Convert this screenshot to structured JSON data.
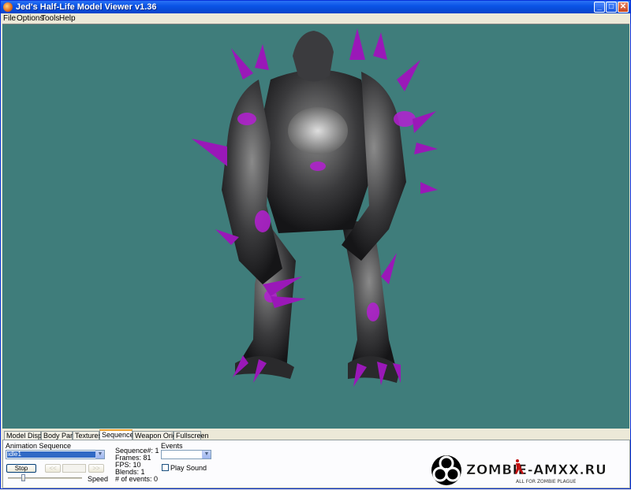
{
  "window": {
    "title": "Jed's Half-Life Model Viewer v1.36"
  },
  "titlebar_buttons": {
    "minimize": "_",
    "maximize": "□",
    "close": "✕"
  },
  "menu": [
    "File",
    "Options",
    "Tools",
    "Help"
  ],
  "tabs": [
    "Model Display",
    "Body Parts",
    "Textures",
    "Sequences",
    "Weapon Origin",
    "Fullscreen"
  ],
  "active_tab": "Sequences",
  "sequences": {
    "animation_label": "Animation Sequence",
    "animation_value": "idle1",
    "stop_label": "Stop",
    "prev_label": "<<",
    "next_label": ">>",
    "speed_label": "Speed",
    "info": {
      "sequence": "Sequence#: 1",
      "frames": "Frames: 81",
      "fps": "FPS: 10",
      "blends": "Blends: 1",
      "events_count": "# of events: 0"
    },
    "events_label": "Events",
    "play_sound_label": "Play Sound",
    "speed_slider_fraction": 0.2
  },
  "logo": {
    "text": "ZOMBIE-AMXX.RU",
    "tagline": "ALL FOR ZOMBIE PLAGUE"
  },
  "colors": {
    "viewport_bg": "#3f7d7b",
    "accent_purple": "#b41fd2"
  },
  "icons": [
    "app-icon",
    "biohazard-icon",
    "player-silhouette-icon"
  ]
}
